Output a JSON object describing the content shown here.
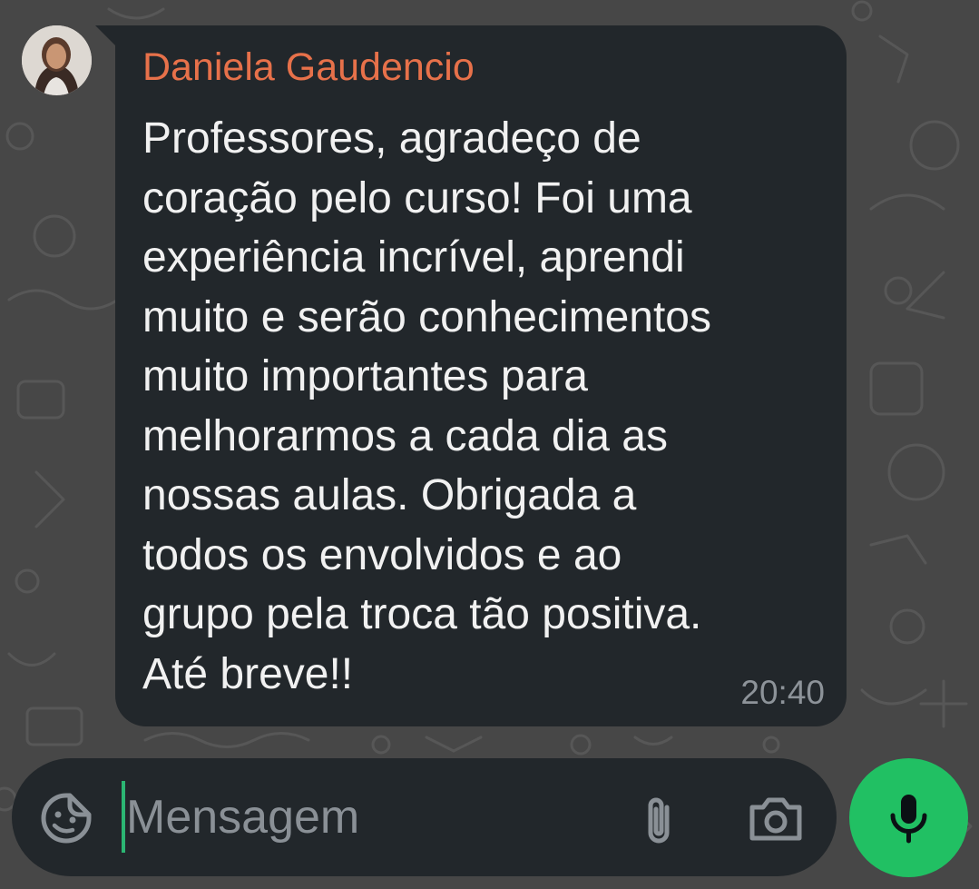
{
  "chat": {
    "message": {
      "sender": "Daniela Gaudencio",
      "lines": [
        "Professores, agradeço de",
        "coração pelo curso! Foi uma",
        "experiência incrível, aprendi",
        "muito e serão conhecimentos",
        "muito importantes para",
        "melhorarmos a cada dia as",
        "nossas aulas. Obrigada a",
        "todos os envolvidos e ao",
        "grupo pela troca tão positiva.",
        "Até breve!!"
      ],
      "time": "20:40"
    }
  },
  "composer": {
    "placeholder": "Mensagem",
    "value": ""
  },
  "icons": {
    "emoji": "sticker-emoji-icon",
    "attach": "paperclip-icon",
    "camera": "camera-icon",
    "mic": "microphone-icon"
  },
  "colors": {
    "background": "#474747",
    "bubble": "#22272b",
    "sender_name": "#e7714a",
    "message_text": "#f1f1f1",
    "timestamp": "#8d9399",
    "accent_green": "#21c063",
    "cursor": "#2bb673"
  }
}
